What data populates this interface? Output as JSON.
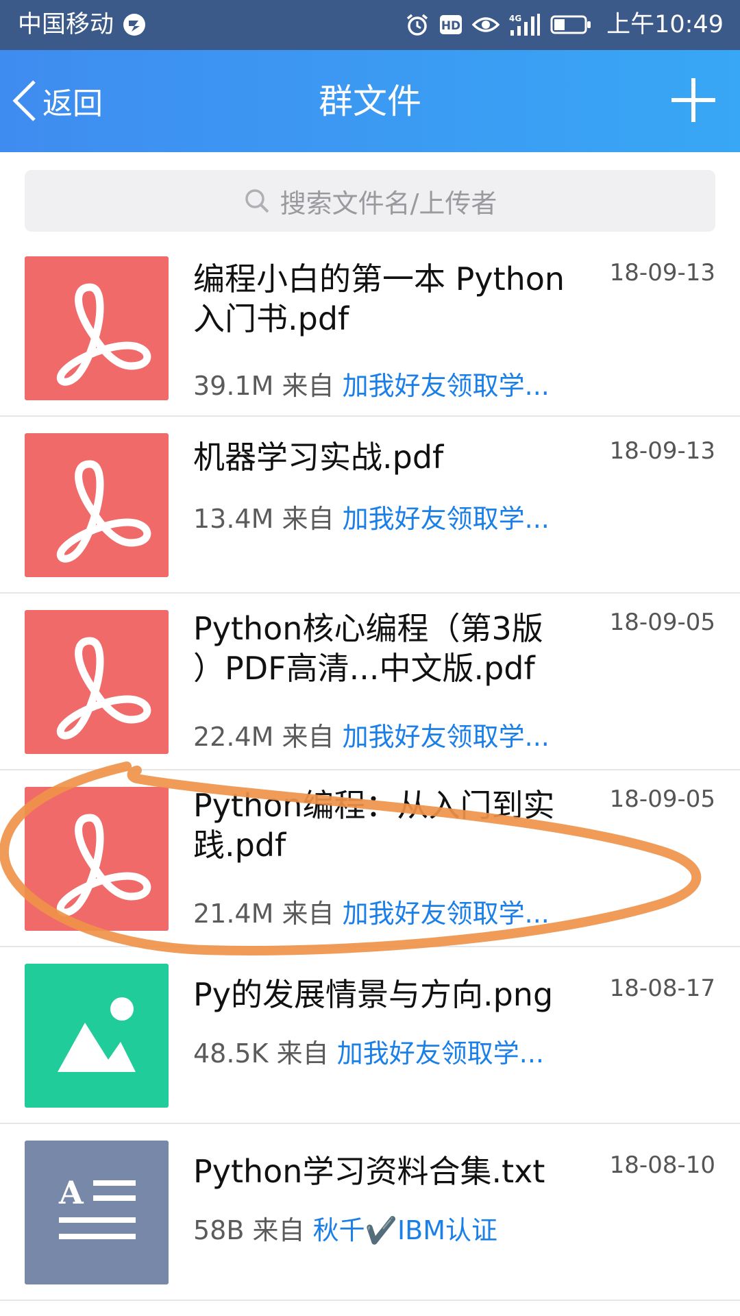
{
  "status_bar": {
    "carrier": "中国移动",
    "time": "上午10:49",
    "icons": [
      "alarm-icon",
      "hd-icon",
      "eye-icon",
      "signal-4g-icon",
      "battery-icon"
    ]
  },
  "header": {
    "back_label": "返回",
    "title": "群文件",
    "add_icon": "plus-icon"
  },
  "search": {
    "placeholder": "搜索文件名/上传者"
  },
  "files": [
    {
      "type": "pdf",
      "name": "编程小白的第一本 Python\n 入门书.pdf",
      "date": "18-09-13",
      "size": "39.1M",
      "from_label": "来自",
      "source": "加我好友领取学..."
    },
    {
      "type": "pdf",
      "name": "机器学习实战.pdf",
      "date": "18-09-13",
      "size": "13.4M",
      "from_label": "来自",
      "source": "加我好友领取学..."
    },
    {
      "type": "pdf",
      "name": "Python核心编程（第3版\n）PDF高清...中文版.pdf",
      "date": "18-09-05",
      "size": "22.4M",
      "from_label": "来自",
      "source": "加我好友领取学..."
    },
    {
      "type": "pdf",
      "name": "Python编程：从入门到实\n践.pdf",
      "date": "18-09-05",
      "size": "21.4M",
      "from_label": "来自",
      "source": "加我好友领取学..."
    },
    {
      "type": "image",
      "name": "Py的发展情景与方向.png",
      "date": "18-08-17",
      "size": "48.5K",
      "from_label": "来自",
      "source": "加我好友领取学..."
    },
    {
      "type": "text",
      "name": "Python学习资料合集.txt",
      "date": "18-08-10",
      "size": "58B",
      "from_label": "来自",
      "source": "秋千✔️IBM认证"
    }
  ],
  "colors": {
    "pdf": "#f06a6a",
    "image": "#1fcc9a",
    "text": "#7888a8",
    "link": "#1b7fe8",
    "annotation": "#f0934a"
  }
}
